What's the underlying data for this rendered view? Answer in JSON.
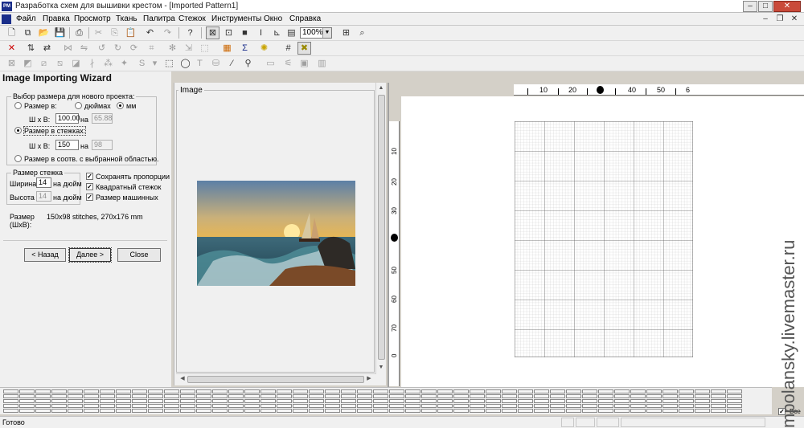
{
  "window": {
    "app_icon": "PM",
    "title": "Разработка схем для вышивки крестом - [Imported Pattern1]",
    "controls": {
      "minimize": "–",
      "maximize": "□",
      "close": "✕"
    }
  },
  "menu": {
    "items": [
      "Файл",
      "Правка",
      "Просмотр",
      "Ткань",
      "Палитра",
      "Стежок",
      "Инструменты",
      "Окно",
      "Справка"
    ],
    "mdi_controls": {
      "minimize": "–",
      "restore": "❐",
      "close": "✕"
    }
  },
  "toolbar": {
    "zoom_value": "100%",
    "zoom_arrow": "▼"
  },
  "wizard": {
    "title": "Image Importing Wizard",
    "size_group": {
      "label": "Выбор размера для нового проекта:",
      "opt_size_in": "Размер в:",
      "unit_inches": "дюймах",
      "unit_mm": "мм",
      "wxh_label_1": "Ш x В:",
      "width_mm": "100.00",
      "on_1": "на",
      "height_mm": "65.88",
      "opt_stitches": "Размер в стежках:",
      "wxh_label_2": "Ш x В:",
      "width_st": "150",
      "on_2": "на",
      "height_st": "98",
      "opt_selection": "Размер в соотв. с выбранной областью."
    },
    "stitch_group": {
      "label": "Размер стежка",
      "width_label": "Ширина",
      "width_value": "14",
      "width_unit": "на дюйм",
      "height_label": "Высота",
      "height_value": "14",
      "height_unit": "на дюйм"
    },
    "checks": {
      "keep_proportions": "Сохранять пропорции",
      "square_stitch": "Квадратный стежок",
      "machine_size": "Размер машинных"
    },
    "size_info": {
      "label_line1": "Размер",
      "label_line2": "(ШxВ):",
      "value": "150x98 stitches,  270x176 mm"
    },
    "buttons": {
      "back": "< Назад",
      "next": "Далее >",
      "close": "Close"
    }
  },
  "image_panel": {
    "label": "Image"
  },
  "ruler": {
    "h_marks": [
      "10",
      "20",
      "40",
      "50",
      "6"
    ],
    "v_marks": [
      "10",
      "20",
      "30",
      "50",
      "60",
      "70",
      "0"
    ]
  },
  "statusbar": {
    "text": "Готово",
    "all_label": "Все"
  },
  "watermark": {
    "text": "mpolansky.livemaster.ru"
  },
  "colors": {
    "chrome": "#f0f0f0",
    "title_icon": "#1a2e8a",
    "close_button": "#c94a3a",
    "grid_fine": "#c8c8c8",
    "grid_major": "#606060"
  }
}
